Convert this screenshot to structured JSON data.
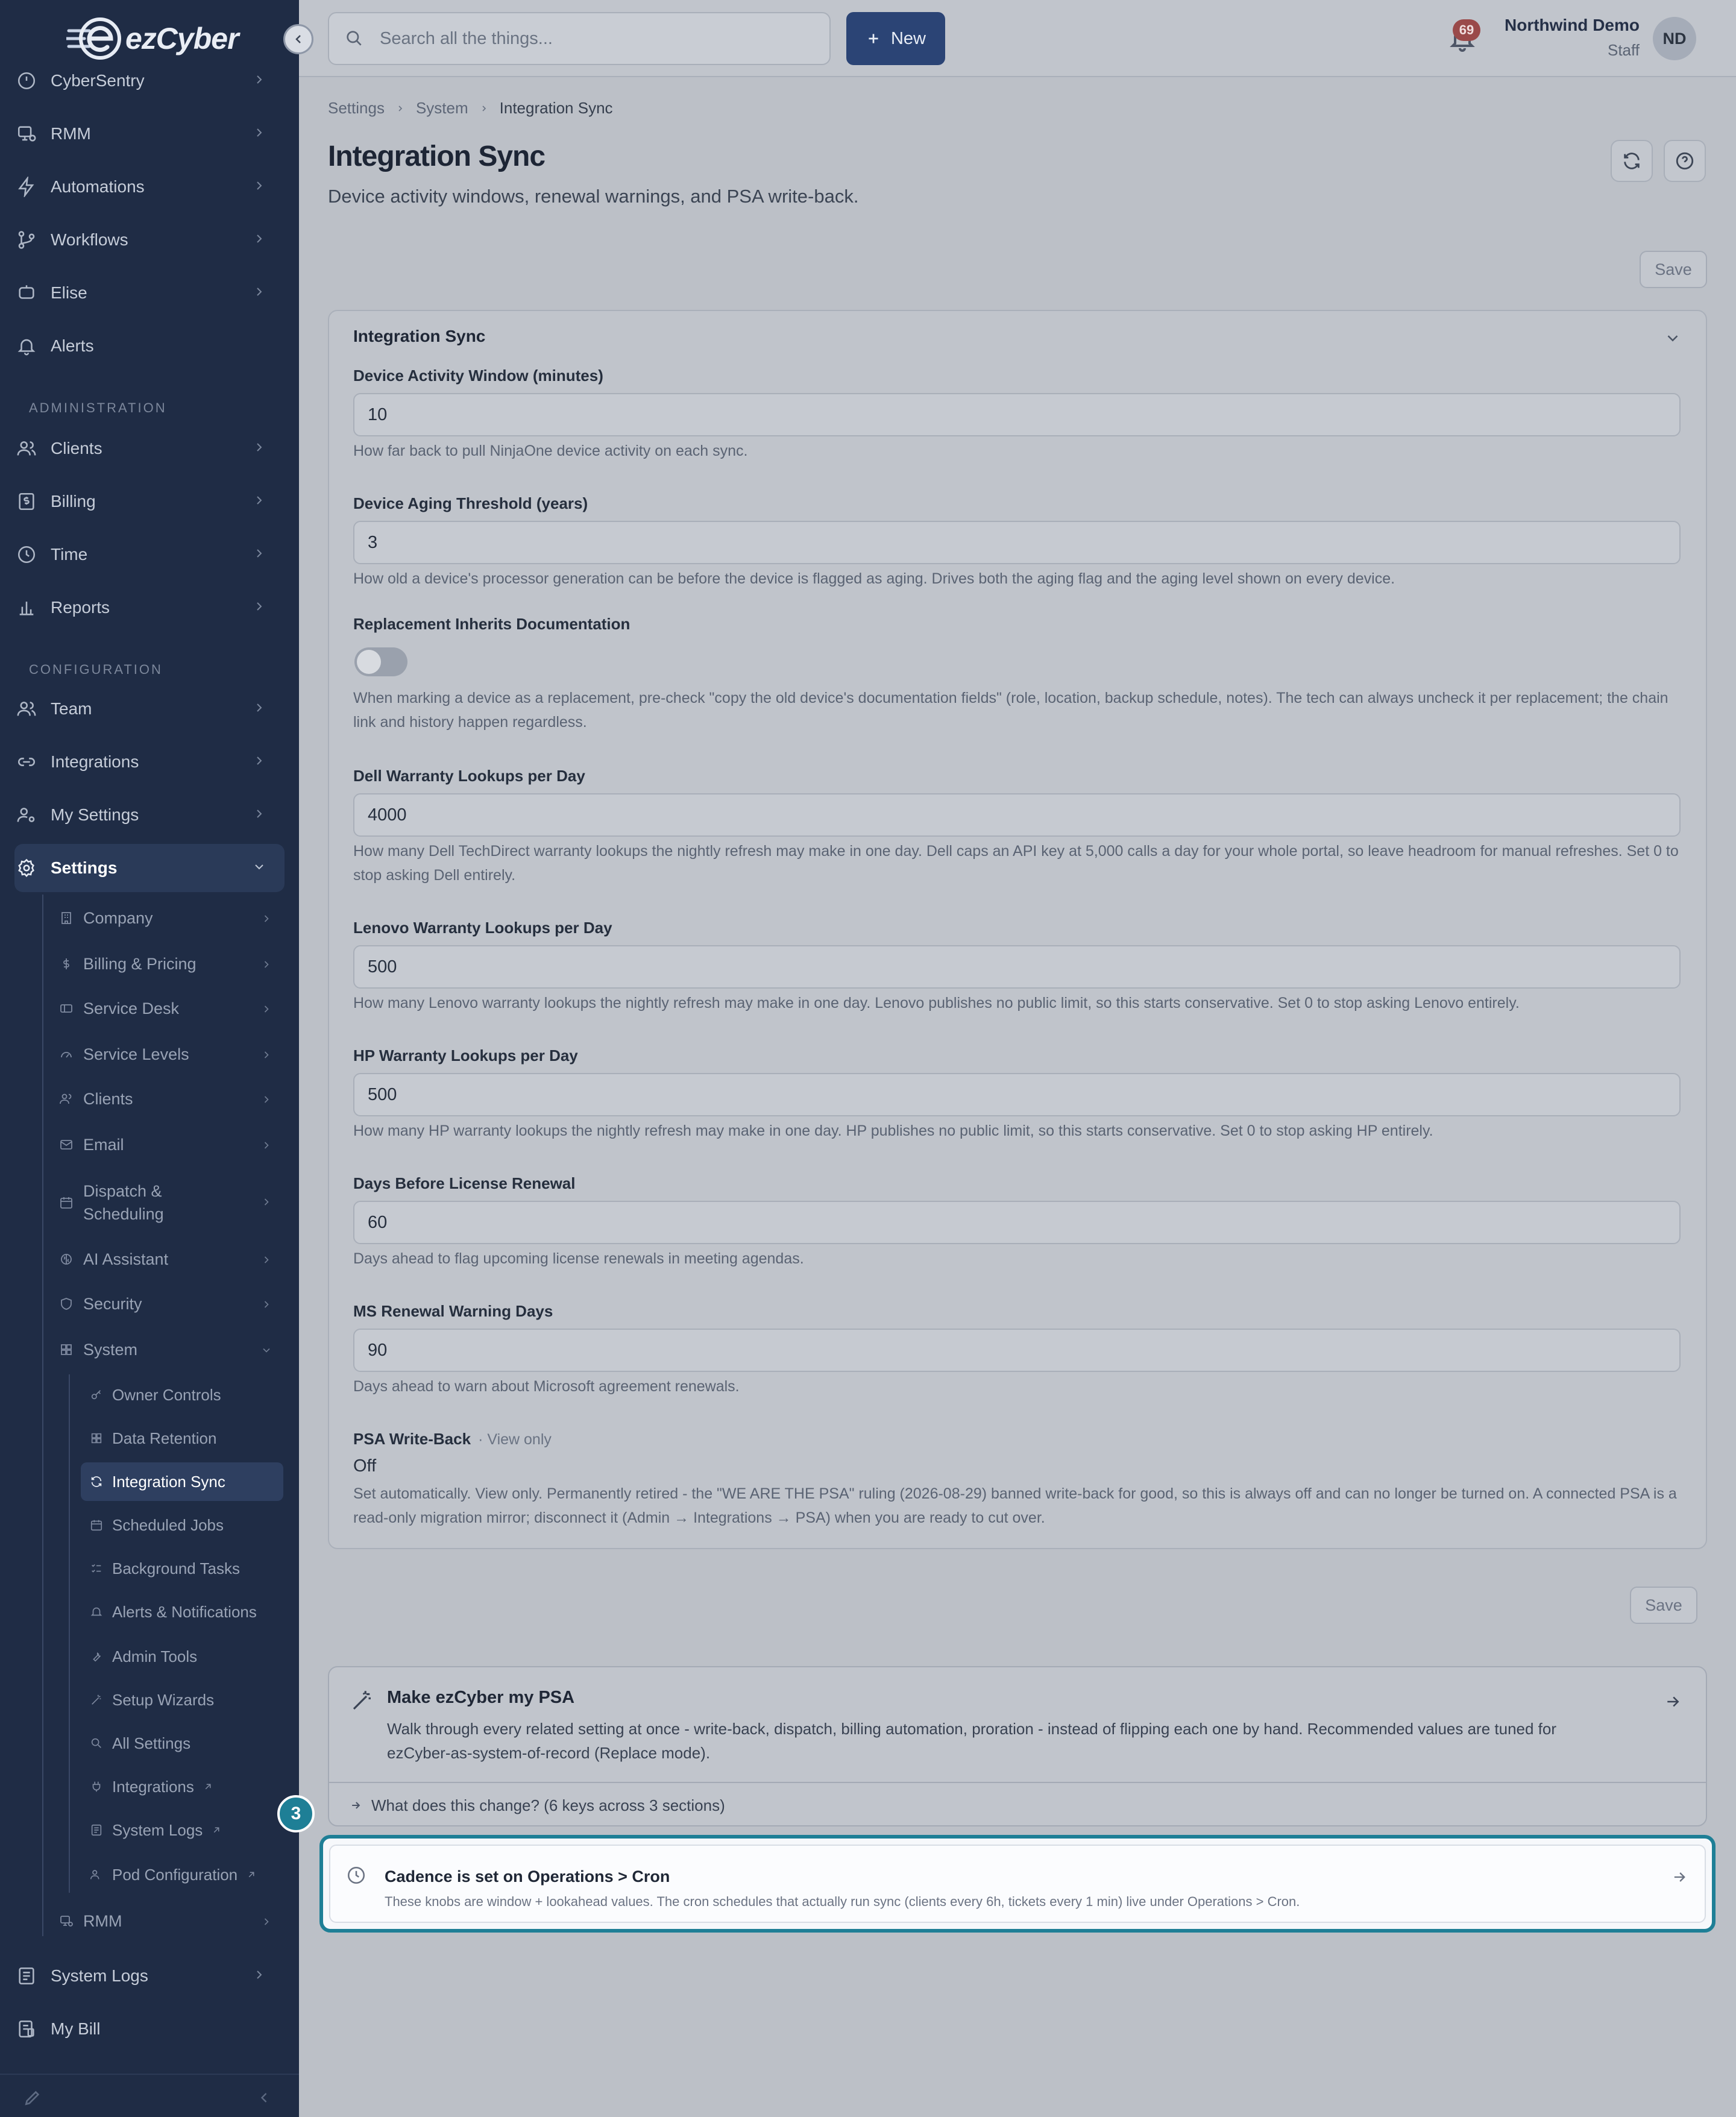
{
  "brand": {
    "logo_text": "ezCyber"
  },
  "sidebar": {
    "top_items": [
      {
        "label": "CyberSentry",
        "icon": "shield-clock-icon"
      },
      {
        "label": "RMM",
        "icon": "monitor-icon"
      },
      {
        "label": "Automations",
        "icon": "bolt-icon"
      },
      {
        "label": "Workflows",
        "icon": "workflow-icon"
      },
      {
        "label": "Elise",
        "icon": "chat-icon"
      },
      {
        "label": "Alerts",
        "icon": "bell-icon"
      }
    ],
    "sections": {
      "administration": "ADMINISTRATION",
      "configuration": "CONFIGURATION"
    },
    "admin_items": [
      {
        "label": "Clients",
        "icon": "users-icon"
      },
      {
        "label": "Billing",
        "icon": "dollar-receipt-icon"
      },
      {
        "label": "Time",
        "icon": "clock-icon"
      },
      {
        "label": "Reports",
        "icon": "bar-chart-icon"
      }
    ],
    "config_items": [
      {
        "label": "Team",
        "icon": "team-icon"
      },
      {
        "label": "Integrations",
        "icon": "link-icon"
      },
      {
        "label": "My Settings",
        "icon": "user-gear-icon"
      },
      {
        "label": "Settings",
        "icon": "gear-icon"
      }
    ],
    "settings_children": [
      {
        "label": "Company"
      },
      {
        "label": "Billing & Pricing"
      },
      {
        "label": "Service Desk"
      },
      {
        "label": "Service Levels"
      },
      {
        "label": "Clients"
      },
      {
        "label": "Email"
      },
      {
        "label": "Dispatch &\nScheduling"
      },
      {
        "label": "AI Assistant"
      },
      {
        "label": "Security"
      },
      {
        "label": "System"
      }
    ],
    "system_children": [
      {
        "label": "Owner Controls"
      },
      {
        "label": "Data Retention"
      },
      {
        "label": "Integration Sync"
      },
      {
        "label": "Scheduled Jobs"
      },
      {
        "label": "Background Tasks"
      },
      {
        "label": "Alerts & Notifications"
      },
      {
        "label": "Admin Tools"
      },
      {
        "label": "Setup Wizards"
      },
      {
        "label": "All Settings"
      },
      {
        "label": "Integrations"
      },
      {
        "label": "System Logs"
      },
      {
        "label": "Pod Configuration"
      }
    ],
    "after_items": [
      {
        "label": "RMM"
      },
      {
        "label": "System Logs"
      },
      {
        "label": "My Bill"
      }
    ]
  },
  "topbar": {
    "search_placeholder": "Search all the things...",
    "new_label": "New",
    "notification_count": "69",
    "user_name": "Northwind Demo",
    "user_role": "Staff",
    "avatar_initials": "ND"
  },
  "breadcrumb": [
    "Settings",
    "System",
    "Integration Sync"
  ],
  "page": {
    "title": "Integration Sync",
    "subtitle": "Device activity windows, renewal warnings, and PSA write-back.",
    "save_label": "Save"
  },
  "card": {
    "title": "Integration Sync",
    "fields": [
      {
        "label": "Device Activity Window (minutes)",
        "value": "10",
        "help": "How far back to pull NinjaOne device activity on each sync."
      },
      {
        "label": "Device Aging Threshold (years)",
        "value": "3",
        "help": "How old a device's processor generation can be before the device is flagged as aging. Drives both the aging flag and the aging level shown on every device."
      },
      {
        "label": "Replacement Inherits Documentation",
        "toggle": false,
        "help": "When marking a device as a replacement, pre-check \"copy the old device's documentation fields\" (role, location, backup schedule, notes). The tech can always uncheck it per replacement; the chain link and history happen regardless."
      },
      {
        "label": "Dell Warranty Lookups per Day",
        "value": "4000",
        "help": "How many Dell TechDirect warranty lookups the nightly refresh may make in one day. Dell caps an API key at 5,000 calls a day for your whole portal, so leave headroom for manual refreshes. Set 0 to stop asking Dell entirely."
      },
      {
        "label": "Lenovo Warranty Lookups per Day",
        "value": "500",
        "help": "How many Lenovo warranty lookups the nightly refresh may make in one day. Lenovo publishes no public limit, so this starts conservative. Set 0 to stop asking Lenovo entirely."
      },
      {
        "label": "HP Warranty Lookups per Day",
        "value": "500",
        "help": "How many HP warranty lookups the nightly refresh may make in one day. HP publishes no public limit, so this starts conservative. Set 0 to stop asking HP entirely."
      },
      {
        "label": "Days Before License Renewal",
        "value": "60",
        "help": "Days ahead to flag upcoming license renewals in meeting agendas."
      },
      {
        "label": "MS Renewal Warning Days",
        "value": "90",
        "help": "Days ahead to warn about Microsoft agreement renewals."
      }
    ],
    "psa": {
      "label": "PSA Write-Back",
      "view_only": "· View only",
      "value": "Off",
      "help": "Set automatically. View only. Permanently retired - the \"WE ARE THE PSA\" ruling (2026-08-29) banned write-back for good, so this is always off and can no longer be turned on. A connected PSA is a read-only migration mirror; disconnect it (Admin → Integrations → PSA) when you are ready to cut over."
    }
  },
  "psa_wizard": {
    "title": "Make ezCyber my PSA",
    "description": "Walk through every related setting at once - write-back, dispatch, billing automation, proration - instead of flipping each one by hand. Recommended values are tuned for ezCyber-as-system-of-record (Replace mode).",
    "expand_label": "What does this change? (6 keys across 3 sections)"
  },
  "cadence": {
    "title": "Cadence is set on Operations > Cron",
    "description": "These knobs are window + lookahead values. The cron schedules that actually run sync (clients every 6h, tickets every 1 min) live under Operations > Cron.",
    "step_number": "3"
  },
  "colors": {
    "sidebar_bg": "#1f2c45",
    "accent": "#2b4475",
    "highlight": "#1e7f96",
    "badge": "#9a4a4a"
  }
}
